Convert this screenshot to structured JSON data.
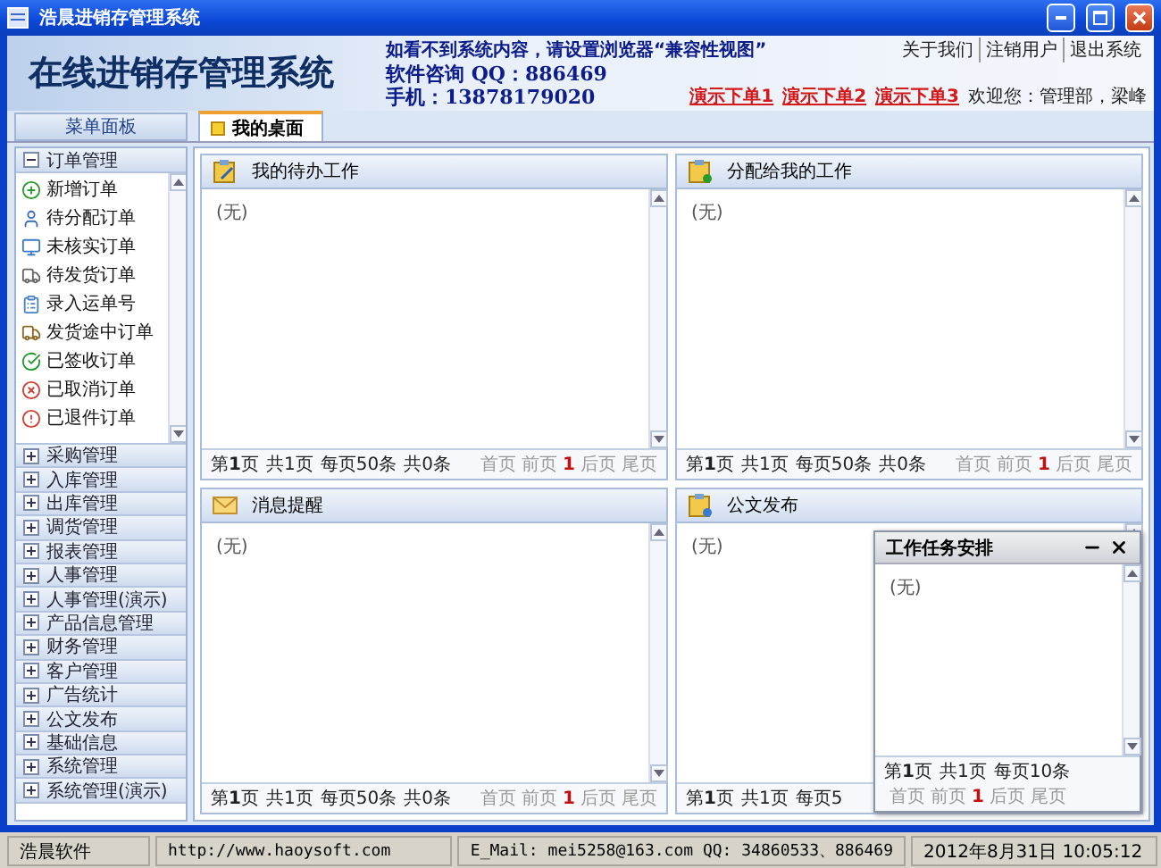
{
  "window": {
    "title": "浩晨进销存管理系统"
  },
  "header": {
    "logo": "在线进销存管理系统",
    "notice": "如看不到系统内容，请设置浏览器“兼容性视图”",
    "consult": "软件咨询 QQ：886469",
    "phone": "手机：13878179020",
    "top_links": [
      "关于我们",
      "注销用户",
      "退出系统"
    ],
    "demo_links": [
      "演示下单1",
      "演示下单2",
      "演示下单3"
    ],
    "welcome": "欢迎您：管理部，梁峰"
  },
  "sidebar": {
    "title": "菜单面板",
    "groups": [
      {
        "label": "订单管理",
        "expanded": true,
        "items": [
          "新增订单",
          "待分配订单",
          "未核实订单",
          "待发货订单",
          "录入运单号",
          "发货途中订单",
          "已签收订单",
          "已取消订单",
          "已退件订单"
        ]
      },
      {
        "label": "采购管理",
        "expanded": false
      },
      {
        "label": "入库管理",
        "expanded": false
      },
      {
        "label": "出库管理",
        "expanded": false
      },
      {
        "label": "调货管理",
        "expanded": false
      },
      {
        "label": "报表管理",
        "expanded": false
      },
      {
        "label": "人事管理",
        "expanded": false
      },
      {
        "label": "人事管理(演示)",
        "expanded": false
      },
      {
        "label": "产品信息管理",
        "expanded": false
      },
      {
        "label": "财务管理",
        "expanded": false
      },
      {
        "label": "客户管理",
        "expanded": false
      },
      {
        "label": "广告统计",
        "expanded": false
      },
      {
        "label": "公文发布",
        "expanded": false
      },
      {
        "label": "基础信息",
        "expanded": false
      },
      {
        "label": "系统管理",
        "expanded": false
      },
      {
        "label": "系统管理(演示)",
        "expanded": false
      }
    ]
  },
  "tabs": [
    {
      "label": "我的桌面",
      "selected": true
    }
  ],
  "panels": [
    {
      "title": "我的待办工作",
      "kind": "todo",
      "empty": "(无)",
      "pager": {
        "info": [
          "第**1**页",
          "共1页",
          "每页50条",
          "共0条"
        ],
        "links": [
          "首页",
          "前页",
          "1",
          "后页",
          "尾页"
        ]
      }
    },
    {
      "title": "分配给我的工作",
      "kind": "assign",
      "empty": "(无)",
      "pager": {
        "info": [
          "第**1**页",
          "共1页",
          "每页50条",
          "共0条"
        ],
        "links": [
          "首页",
          "前页",
          "1",
          "后页",
          "尾页"
        ]
      }
    },
    {
      "title": "消息提醒",
      "kind": "mail",
      "empty": "(无)",
      "pager": {
        "info": [
          "第**1**页",
          "共1页",
          "每页50条",
          "共0条"
        ],
        "links": [
          "首页",
          "前页",
          "1",
          "后页",
          "尾页"
        ]
      }
    },
    {
      "title": "公文发布",
      "kind": "doc",
      "empty": "(无)",
      "pager": {
        "info": [
          "第**1**页",
          "共1页",
          "每页5"
        ]
      }
    }
  ],
  "popup": {
    "title": "工作任务安排",
    "empty": "(无)",
    "pager": {
      "info": [
        "第**1**页",
        "共1页",
        "每页10条"
      ],
      "links": [
        "首页",
        "前页",
        "1",
        "后页",
        "尾页"
      ]
    }
  },
  "status_bar": [
    "浩晨软件",
    "http://www.haoysoft.com",
    "E_Mail: mei5258@163.com  QQ: 34860533、886469",
    "2012年8月31日 10:05:12"
  ]
}
